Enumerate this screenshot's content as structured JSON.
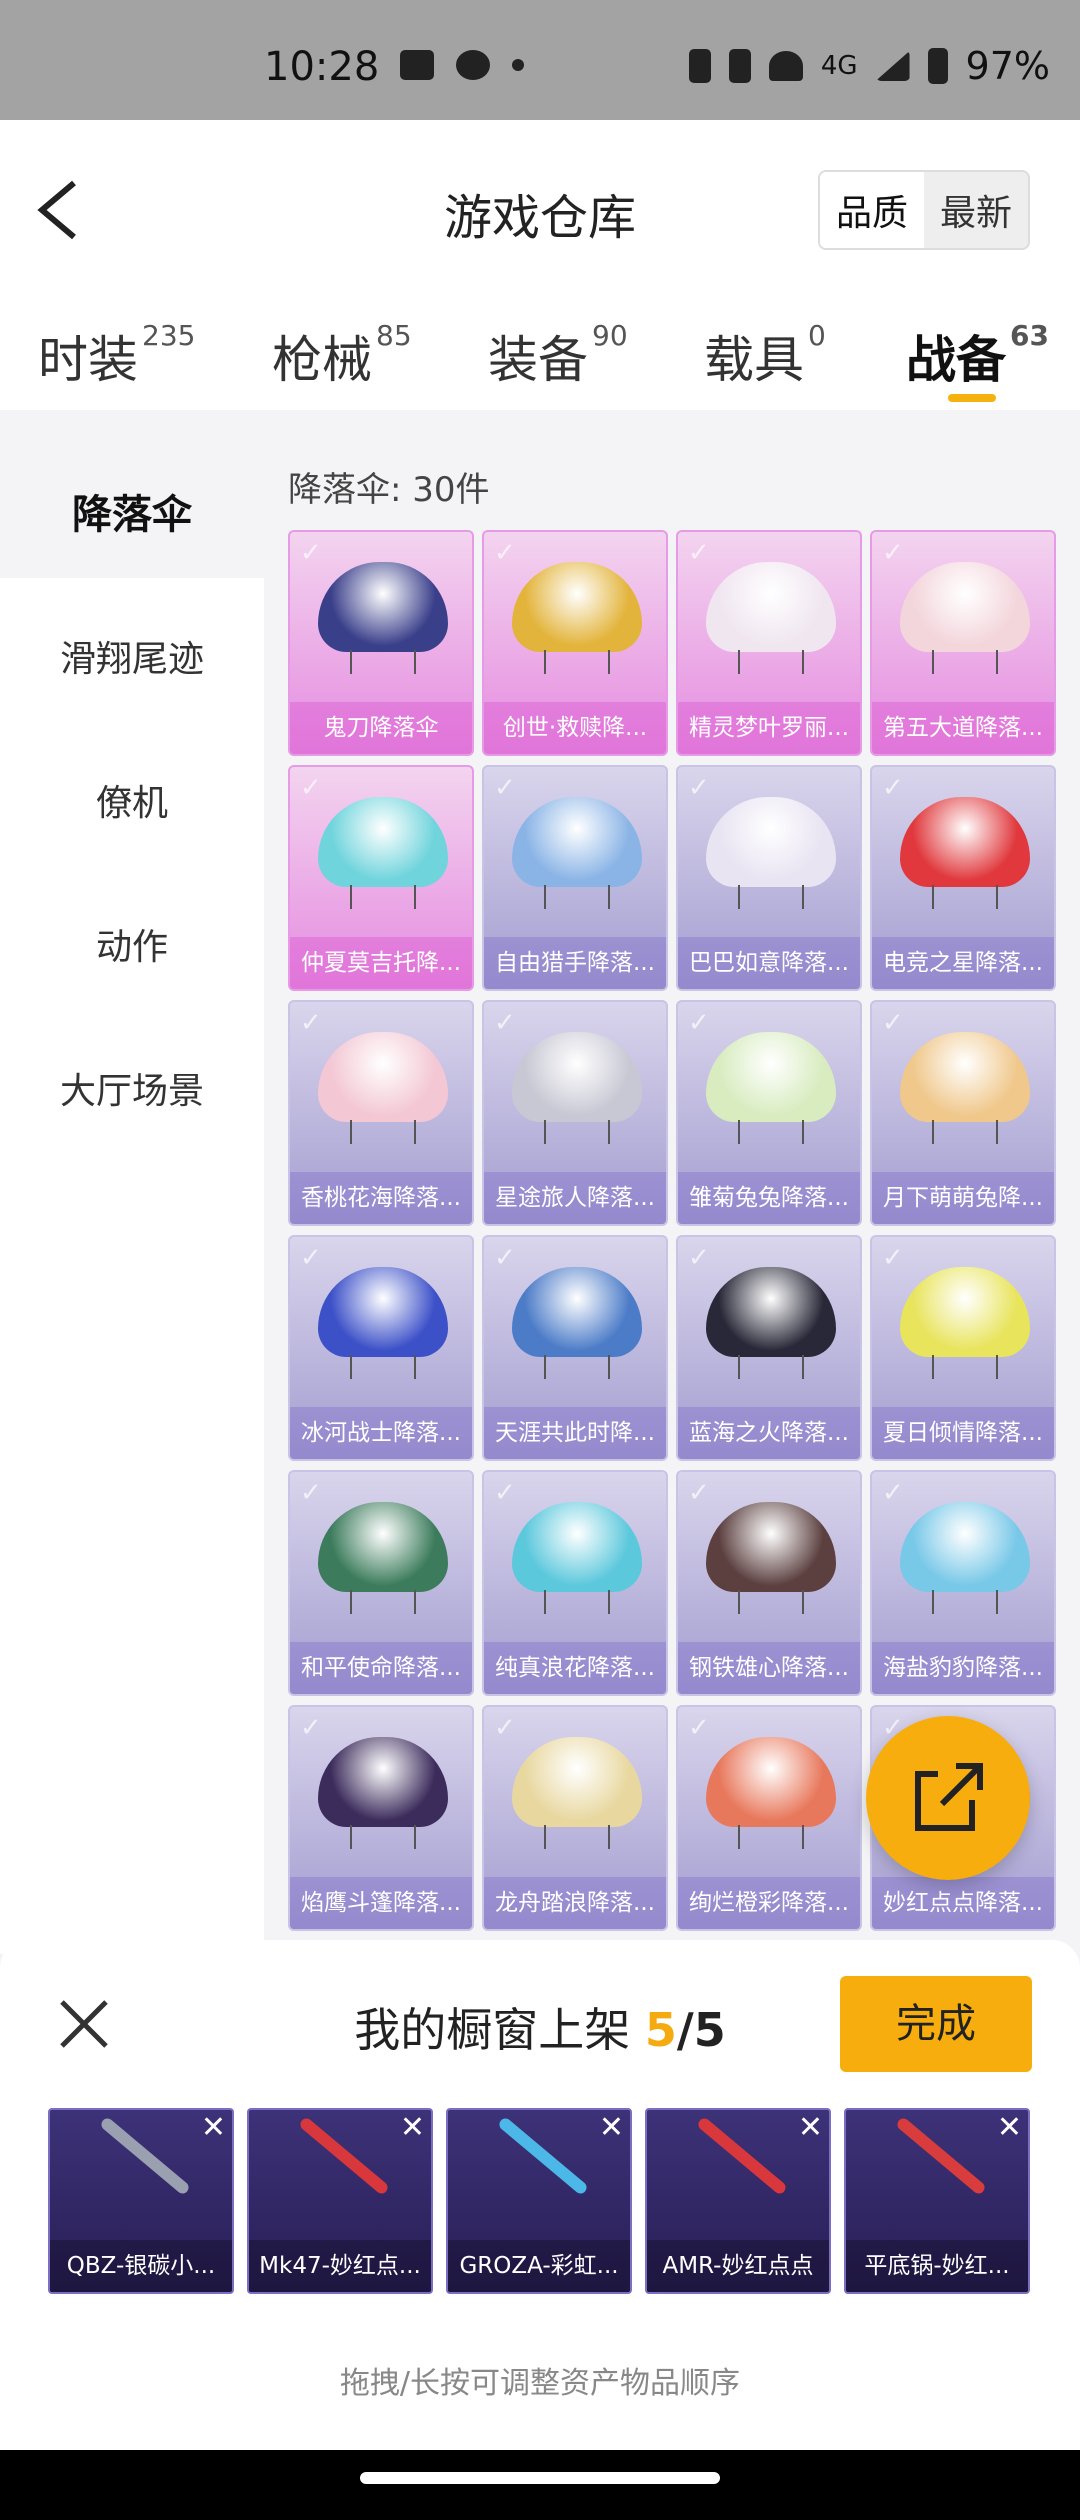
{
  "status_bar": {
    "time": "10:28",
    "network": "4G",
    "battery": "97%"
  },
  "header": {
    "title": "游戏仓库",
    "sort_options": [
      "品质",
      "最新"
    ],
    "sort_active": "品质"
  },
  "tabs": [
    {
      "label": "时装",
      "count": "235"
    },
    {
      "label": "枪械",
      "count": "85"
    },
    {
      "label": "装备",
      "count": "90"
    },
    {
      "label": "载具",
      "count": "0"
    },
    {
      "label": "战备",
      "count": "63"
    }
  ],
  "active_tab": "战备",
  "sidebar": {
    "items": [
      "降落伞",
      "滑翔尾迹",
      "僚机",
      "动作",
      "大厅场景"
    ],
    "active": "降落伞"
  },
  "category_count": "降落伞: 30件",
  "grid_items": [
    {
      "name": "鬼刀降落伞",
      "color": "#3a3f8a",
      "rarity": "pink"
    },
    {
      "name": "创世·救赎降...",
      "color": "#e3b43b",
      "rarity": "pink"
    },
    {
      "name": "精灵梦叶罗丽...",
      "color": "#f0e6f0",
      "rarity": "pink"
    },
    {
      "name": "第五大道降落...",
      "color": "#f3d6dc",
      "rarity": "pink"
    },
    {
      "name": "仲夏莫吉托降...",
      "color": "#6fd4dc",
      "rarity": "pink"
    },
    {
      "name": "自由猎手降落...",
      "color": "#8ab4e6",
      "rarity": "purple"
    },
    {
      "name": "巴巴如意降落...",
      "color": "#e8e4f2",
      "rarity": "purple"
    },
    {
      "name": "电竞之星降落...",
      "color": "#e0383c",
      "rarity": "purple"
    },
    {
      "name": "香桃花海降落...",
      "color": "#f3c8d4",
      "rarity": "purple"
    },
    {
      "name": "星途旅人降落...",
      "color": "#c8c8d4",
      "rarity": "purple"
    },
    {
      "name": "雏菊兔兔降落...",
      "color": "#d8ecc0",
      "rarity": "purple"
    },
    {
      "name": "月下萌萌兔降...",
      "color": "#f0c88c",
      "rarity": "purple"
    },
    {
      "name": "冰河战士降落...",
      "color": "#3c50c8",
      "rarity": "purple"
    },
    {
      "name": "天涯共此时降...",
      "color": "#4c7cc8",
      "rarity": "purple"
    },
    {
      "name": "蓝海之火降落...",
      "color": "#282838",
      "rarity": "purple"
    },
    {
      "name": "夏日倾情降落...",
      "color": "#e8e45c",
      "rarity": "purple"
    },
    {
      "name": "和平使命降落...",
      "color": "#3c7c5c",
      "rarity": "purple"
    },
    {
      "name": "纯真浪花降落...",
      "color": "#5cc8dc",
      "rarity": "purple"
    },
    {
      "name": "钢铁雄心降落...",
      "color": "#5c4040",
      "rarity": "purple"
    },
    {
      "name": "海盐豹豹降落...",
      "color": "#78c8e8",
      "rarity": "purple"
    },
    {
      "name": "焰鹰斗篷降落...",
      "color": "#3c2c5c",
      "rarity": "purple"
    },
    {
      "name": "龙舟踏浪降落...",
      "color": "#e8d8a0",
      "rarity": "purple"
    },
    {
      "name": "绚烂橙彩降落...",
      "color": "#e8785c",
      "rarity": "purple"
    },
    {
      "name": "妙红点点降落...",
      "color": "#e84c5c",
      "rarity": "purple"
    }
  ],
  "panel": {
    "title": "我的橱窗上架",
    "current": "5",
    "separator": "/",
    "total": "5",
    "done_label": "完成",
    "hint": "拖拽/长按可调整资产物品顺序",
    "showcase": [
      {
        "name": "QBZ-银碳小...",
        "color": "#9aa0b0"
      },
      {
        "name": "Mk47-妙红点...",
        "color": "#d8383c"
      },
      {
        "name": "GROZA-彩虹...",
        "color": "#4cb8e8"
      },
      {
        "name": "AMR-妙红点点",
        "color": "#d8383c"
      },
      {
        "name": "平底锅-妙红...",
        "color": "#d83c3c"
      }
    ]
  }
}
